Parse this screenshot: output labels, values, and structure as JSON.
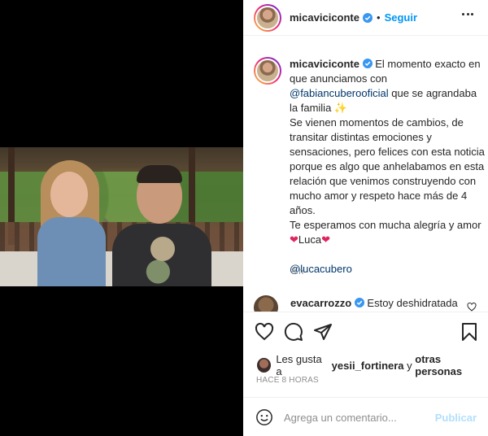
{
  "header": {
    "username": "micaviciconte",
    "separator": "•",
    "follow_label": "Seguir"
  },
  "caption": {
    "username": "micaviciconte",
    "line1": "El momento exacto en que anunciamos con",
    "mention1": "@fabiancuberooficial",
    "line2": "que se agrandaba la familia",
    "sparkle": "✨",
    "line3": "Se vienen momentos de cambios, de transitar distintas emociones y sensaciones, pero felices con esta noticia porque es algo que anhelabamos en esta relación que venimos construyendo con mucho amor y respeto hace más de 4 años.",
    "line4": "Te esperamos con mucha alegría y amor",
    "heart": "❤",
    "baby_name": "Luca",
    "mention2": "@lucacubero",
    "time": "8 h"
  },
  "comment": {
    "username": "evacarrozzo",
    "text": "Estoy deshidratada"
  },
  "likes": {
    "prefix": "Les gusta a",
    "user": "yesii_fortinera",
    "conjunction": "y",
    "others": "otras personas"
  },
  "timestamp": "HACE 8 HORAS",
  "add_comment": {
    "placeholder": "Agrega un comentario...",
    "publish_label": "Publicar"
  },
  "colors": {
    "accent": "#0095f6",
    "publish_disabled": "#b2dffc",
    "muted": "#8e8e8e",
    "heart": "#e0245e",
    "mention": "#00376b"
  },
  "icons": [
    "verified-badge-icon",
    "more-options-icon",
    "like-heart-icon",
    "comment-bubble-icon",
    "share-send-icon",
    "bookmark-icon",
    "emoji-icon",
    "comment-like-icon"
  ]
}
